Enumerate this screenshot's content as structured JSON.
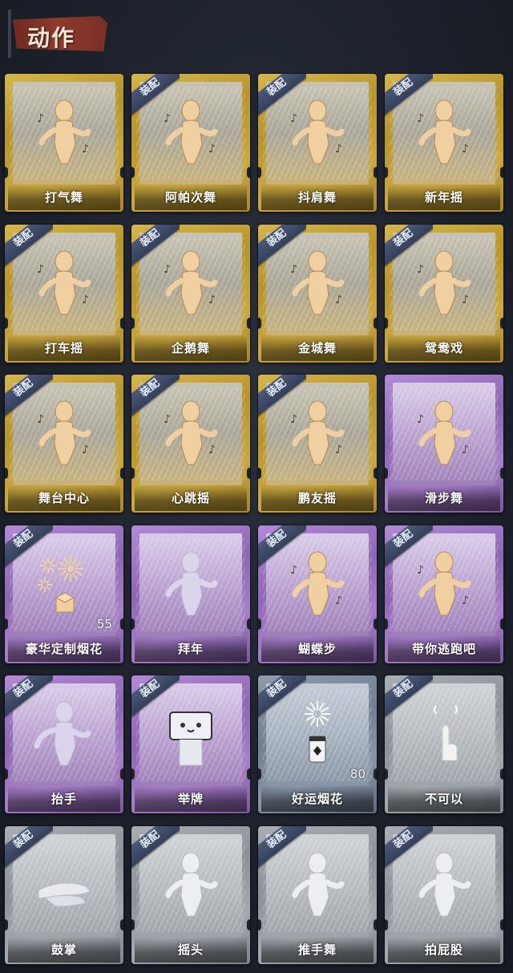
{
  "header": {
    "title": "动作"
  },
  "badge_text": "装配",
  "cards": [
    {
      "label": "打气舞",
      "tier": "gold",
      "equipped": false,
      "icon": "dance-figure-icon"
    },
    {
      "label": "阿帕次舞",
      "tier": "gold",
      "equipped": true,
      "icon": "dance-figure-icon"
    },
    {
      "label": "抖肩舞",
      "tier": "gold",
      "equipped": true,
      "icon": "dance-figure-icon"
    },
    {
      "label": "新年摇",
      "tier": "gold",
      "equipped": true,
      "icon": "dance-figure-icon"
    },
    {
      "label": "打车摇",
      "tier": "gold",
      "equipped": true,
      "icon": "dance-figure-icon"
    },
    {
      "label": "企鹅舞",
      "tier": "gold",
      "equipped": true,
      "icon": "dance-figure-icon"
    },
    {
      "label": "金城舞",
      "tier": "gold",
      "equipped": true,
      "icon": "dance-figure-icon"
    },
    {
      "label": "鸳鸯戏",
      "tier": "gold",
      "equipped": true,
      "icon": "dance-figure-icon"
    },
    {
      "label": "舞台中心",
      "tier": "gold",
      "equipped": true,
      "icon": "dance-figure-icon"
    },
    {
      "label": "心跳摇",
      "tier": "gold",
      "equipped": true,
      "icon": "dance-figure-icon"
    },
    {
      "label": "鹏友摇",
      "tier": "gold",
      "equipped": true,
      "icon": "dance-figure-icon"
    },
    {
      "label": "滑步舞",
      "tier": "purple",
      "equipped": false,
      "icon": "dance-figure-icon"
    },
    {
      "label": "豪华定制烟花",
      "tier": "purple",
      "equipped": true,
      "icon": "fireworks-icon",
      "count": "55"
    },
    {
      "label": "拜年",
      "tier": "purple",
      "equipped": false,
      "icon": "greeting-figure-icon"
    },
    {
      "label": "蝴蝶步",
      "tier": "purple",
      "equipped": true,
      "icon": "dance-figure-icon"
    },
    {
      "label": "带你逃跑吧",
      "tier": "purple",
      "equipped": true,
      "icon": "dance-figure-icon"
    },
    {
      "label": "抬手",
      "tier": "purple",
      "equipped": true,
      "icon": "raise-hand-figure-icon"
    },
    {
      "label": "举牌",
      "tier": "purple",
      "equipped": true,
      "icon": "sign-holding-figure-icon"
    },
    {
      "label": "好运烟花",
      "tier": "bluegrey",
      "equipped": true,
      "icon": "firework-can-icon",
      "count": "80"
    },
    {
      "label": "不可以",
      "tier": "grey",
      "equipped": true,
      "icon": "finger-wag-icon"
    },
    {
      "label": "鼓掌",
      "tier": "grey",
      "equipped": true,
      "icon": "clapping-hands-icon"
    },
    {
      "label": "摇头",
      "tier": "grey",
      "equipped": true,
      "icon": "head-shake-figure-icon"
    },
    {
      "label": "推手舞",
      "tier": "grey",
      "equipped": true,
      "icon": "dance-figure-icon"
    },
    {
      "label": "拍屁股",
      "tier": "grey",
      "equipped": true,
      "icon": "dance-figure-icon"
    }
  ]
}
